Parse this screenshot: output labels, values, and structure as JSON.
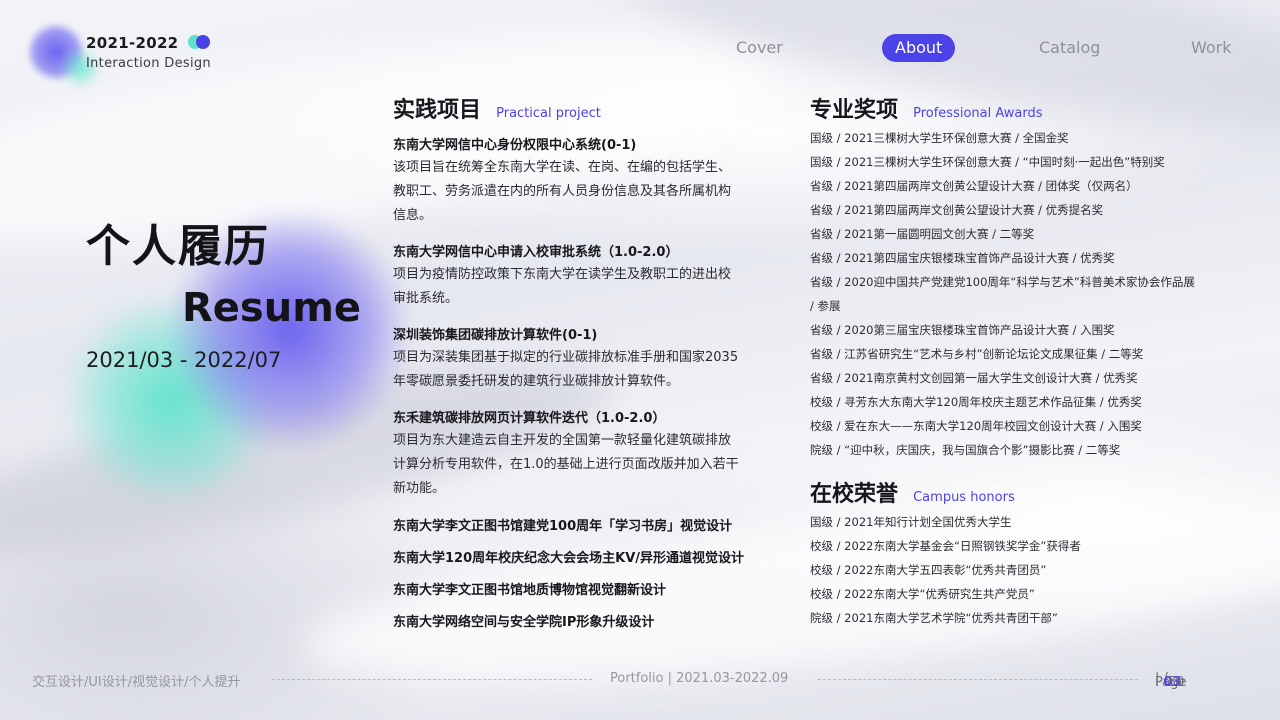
{
  "brand": {
    "year": "2021-2022",
    "subtitle": "Interaction Design"
  },
  "nav": {
    "cover": "Cover",
    "about": "About",
    "catalog": "Catalog",
    "work": "Work"
  },
  "hero": {
    "title_cn": "个人履历",
    "title_en": "Resume",
    "date_range": "2021/03 - 2022/07"
  },
  "projects": {
    "heading_cn": "实践项目",
    "heading_en": "Practical project",
    "items": [
      {
        "title": "东南大学网信中心身份权限中心系统(0-1)",
        "desc": "该项目旨在统筹全东南大学在读、在岗、在编的包括学生、教职工、劳务派遣在内的所有人员身份信息及其各所属机构信息。"
      },
      {
        "title": "东南大学网信中心申请入校审批系统（1.0-2.0）",
        "desc": "项目为疫情防控政策下东南大学在读学生及教职工的进出校审批系统。"
      },
      {
        "title": "深圳装饰集团碳排放计算软件(0-1)",
        "desc": "项目为深装集团基于拟定的行业碳排放标准手册和国家2035年零碳愿景委托研发的建筑行业碳排放计算软件。"
      },
      {
        "title": "东禾建筑碳排放网页计算软件迭代（1.0-2.0）",
        "desc": "项目为东大建造云自主开发的全国第一款轻量化建筑碳排放计算分析专用软件，在1.0的基础上进行页面改版并加入若干新功能。"
      },
      {
        "title": "东南大学李文正图书馆建党100周年「学习书房」视觉设计"
      },
      {
        "title": "东南大学120周年校庆纪念大会会场主KV/异形通道视觉设计"
      },
      {
        "title": "东南大学李文正图书馆地质博物馆视觉翻新设计"
      },
      {
        "title": "东南大学网络空间与安全学院IP形象升级设计"
      }
    ]
  },
  "awards": {
    "heading_cn": "专业奖项",
    "heading_en": "Professional Awards",
    "items": [
      "国级 / 2021三棵树大学生环保创意大赛 / 全国金奖",
      "国级 / 2021三棵树大学生环保创意大赛 / “中国时刻·一起出色”特别奖",
      "省级 / 2021第四届两岸文创黄公望设计大赛 / 团体奖（仅两名）",
      "省级 / 2021第四届两岸文创黄公望设计大赛 / 优秀提名奖",
      "省级 / 2021第一届圆明园文创大赛 / 二等奖",
      "省级 / 2021第四届宝庆银楼珠宝首饰产品设计大赛 / 优秀奖",
      "省级 / 2020迎中国共产党建党100周年“科学与艺术”科普美术家协会作品展 / 参展",
      "省级 / 2020第三届宝庆银楼珠宝首饰产品设计大赛 / 入围奖",
      "省级 / 江苏省研究生“艺术与乡村”创新论坛论文成果征集 / 二等奖",
      "省级 / 2021南京黄村文创园第一届大学生文创设计大赛 / 优秀奖",
      "校级 / 寻芳东大东南大学120周年校庆主题艺术作品征集 / 优秀奖",
      "校级 / 爱在东大——东南大学120周年校园文创设计大赛 / 入围奖",
      "院级 / “迎中秋，庆国庆，我与国旗合个影”摄影比赛 / 二等奖"
    ]
  },
  "honors": {
    "heading_cn": "在校荣誉",
    "heading_en": "Campus honors",
    "items": [
      "国级 / 2021年知行计划全国优秀大学生",
      "校级 / 2022东南大学基金会“日照钢铁奖学金”获得者",
      "校级 / 2022东南大学五四表彰“优秀共青团员”",
      "校级 / 2022东南大学“优秀研究生共产党员”",
      "院级 / 2021东南大学艺术学院“优秀共青团干部”"
    ]
  },
  "footer": {
    "left": "交互设计/UI设计/视觉设计/个人提升",
    "center": "Portfolio | 2021.03-2022.09",
    "page_label": "Page",
    "page_current": "03",
    "page_total": "50"
  }
}
